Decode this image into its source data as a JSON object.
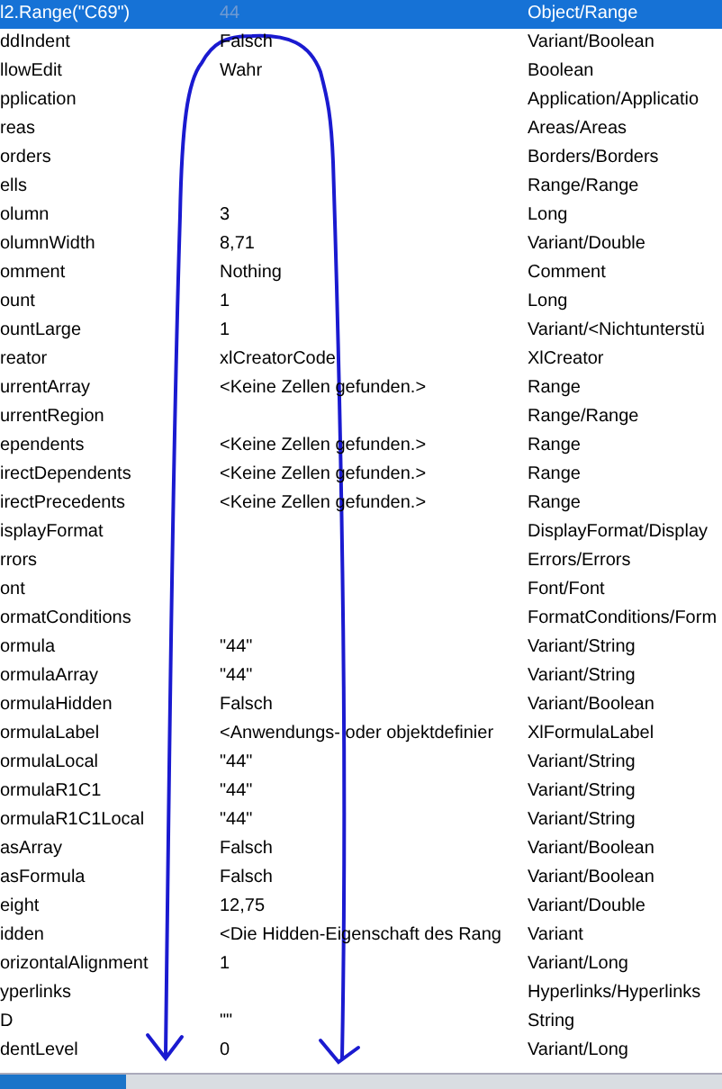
{
  "rows": [
    {
      "name": "l2.Range(\"C69\")",
      "value": "44",
      "type": "Object/Range",
      "selected": true
    },
    {
      "name": "ddIndent",
      "value": "Falsch",
      "type": "Variant/Boolean",
      "selected": false
    },
    {
      "name": "llowEdit",
      "value": "Wahr",
      "type": "Boolean",
      "selected": false
    },
    {
      "name": "pplication",
      "type": "Application/Applicatio",
      "selected": false
    },
    {
      "name": "reas",
      "type": "Areas/Areas",
      "selected": false
    },
    {
      "name": "orders",
      "type": "Borders/Borders",
      "selected": false
    },
    {
      "name": "ells",
      "type": "Range/Range",
      "selected": false
    },
    {
      "name": "olumn",
      "value": "3",
      "type": "Long",
      "selected": false
    },
    {
      "name": "olumnWidth",
      "value": "8,71",
      "type": "Variant/Double",
      "selected": false
    },
    {
      "name": "omment",
      "value": "Nothing",
      "type": "Comment",
      "selected": false
    },
    {
      "name": "ount",
      "value": "1",
      "type": "Long",
      "selected": false
    },
    {
      "name": "ountLarge",
      "value": "1",
      "type": "Variant/<Nichtunterstü",
      "selected": false
    },
    {
      "name": "reator",
      "value": "xlCreatorCode",
      "type": "XlCreator",
      "selected": false
    },
    {
      "name": "urrentArray",
      "value": "<Keine Zellen gefunden.>",
      "type": "Range",
      "selected": false
    },
    {
      "name": "urrentRegion",
      "type": "Range/Range",
      "selected": false
    },
    {
      "name": "ependents",
      "value": "<Keine Zellen gefunden.>",
      "type": "Range",
      "selected": false
    },
    {
      "name": "irectDependents",
      "value": "<Keine Zellen gefunden.>",
      "type": "Range",
      "selected": false
    },
    {
      "name": "irectPrecedents",
      "value": "<Keine Zellen gefunden.>",
      "type": "Range",
      "selected": false
    },
    {
      "name": "isplayFormat",
      "type": "DisplayFormat/Display",
      "selected": false
    },
    {
      "name": "rrors",
      "type": "Errors/Errors",
      "selected": false
    },
    {
      "name": "ont",
      "type": "Font/Font",
      "selected": false
    },
    {
      "name": "ormatConditions",
      "type": "FormatConditions/Form",
      "selected": false
    },
    {
      "name": "ormula",
      "value": "\"44\"",
      "type": "Variant/String",
      "selected": false
    },
    {
      "name": "ormulaArray",
      "value": "\"44\"",
      "type": "Variant/String",
      "selected": false
    },
    {
      "name": "ormulaHidden",
      "value": "Falsch",
      "type": "Variant/Boolean",
      "selected": false
    },
    {
      "name": "ormulaLabel",
      "value": "<Anwendungs- oder objektdefinier",
      "type": "XlFormulaLabel",
      "selected": false
    },
    {
      "name": "ormulaLocal",
      "value": "\"44\"",
      "type": "Variant/String",
      "selected": false
    },
    {
      "name": "ormulaR1C1",
      "value": "\"44\"",
      "type": "Variant/String",
      "selected": false
    },
    {
      "name": "ormulaR1C1Local",
      "value": "\"44\"",
      "type": "Variant/String",
      "selected": false
    },
    {
      "name": "asArray",
      "value": "Falsch",
      "type": "Variant/Boolean",
      "selected": false
    },
    {
      "name": "asFormula",
      "value": "Falsch",
      "type": "Variant/Boolean",
      "selected": false
    },
    {
      "name": "eight",
      "value": "12,75",
      "type": "Variant/Double",
      "selected": false
    },
    {
      "name": "idden",
      "value": "<Die Hidden-Eigenschaft des Rang",
      "type": "Variant",
      "selected": false
    },
    {
      "name": "orizontalAlignment",
      "value": "1",
      "type": "Variant/Long",
      "selected": false
    },
    {
      "name": "yperlinks",
      "type": "Hyperlinks/Hyperlinks",
      "selected": false
    },
    {
      "name": "D",
      "value": "\"\"",
      "type": "String",
      "selected": false
    },
    {
      "name": "dentLevel",
      "value": "0",
      "type": "Variant/Long",
      "selected": false
    }
  ]
}
